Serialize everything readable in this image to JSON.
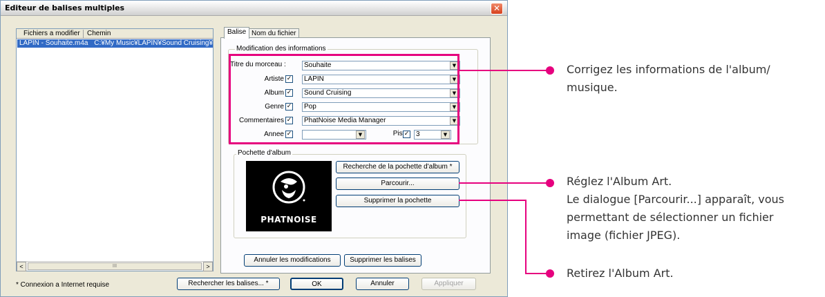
{
  "window": {
    "title": "Editeur de balises multiples",
    "close_glyph": "✕"
  },
  "file_list": {
    "columns": [
      "Fichiers a modifier",
      "Chemin"
    ],
    "rows": [
      {
        "file": "LAPIN - Souhaite.m4a",
        "path": "C:¥My Music¥LAPIN¥Sound Cruising¥"
      }
    ],
    "scroll_left": "<",
    "scroll_right": ">",
    "thumb_grip": "III"
  },
  "tabs": [
    {
      "label": "Balise",
      "selected": true
    },
    {
      "label": "Nom du fichier",
      "selected": false
    }
  ],
  "info_group": {
    "title": "Modification des informations",
    "fields": {
      "titre": {
        "label": "Titre du morceau :",
        "value": "Souhaite"
      },
      "artiste": {
        "label": "Artiste",
        "value": "LAPIN",
        "checked": true
      },
      "album": {
        "label": "Album",
        "value": "Sound Cruising",
        "checked": true
      },
      "genre": {
        "label": "Genre",
        "value": "Pop",
        "checked": true
      },
      "commentaires": {
        "label": "Commentaires",
        "value": "PhatNoise Media Manager",
        "checked": true
      },
      "annee": {
        "label": "Annee",
        "value": "",
        "checked": true
      },
      "piste": {
        "label": "Piste",
        "value": "3",
        "checked": true
      }
    },
    "check_glyph": "✓",
    "dropdown_glyph": "▼"
  },
  "album_art_group": {
    "title": "Pochette d'album",
    "logo_text": "PHATNOISE",
    "buttons": {
      "search": "Recherche de la pochette d'album *",
      "browse": "Parcourir...",
      "delete": "Supprimer la pochette"
    }
  },
  "panel_buttons": {
    "cancel_changes": "Annuler les modifications",
    "delete_tags": "Supprimer les balises"
  },
  "footer": {
    "note": "* Connexion a Internet requise",
    "search_tags": "Rechercher les balises... *",
    "ok": "OK",
    "cancel": "Annuler",
    "apply": "Appliquer"
  },
  "annotations": {
    "info": [
      "Corrigez les informations de l'album/",
      "musique."
    ],
    "album_art": [
      "Réglez l'Album Art.",
      "Le dialogue [Parcourir...] apparaît, vous",
      "permettant de sélectionner un fichier",
      "image (fichier JPEG)."
    ],
    "remove": "Retirez l'Album Art."
  },
  "colors": {
    "accent": "#e6007e",
    "selection": "#316ac5",
    "window": "#ece9d8"
  }
}
